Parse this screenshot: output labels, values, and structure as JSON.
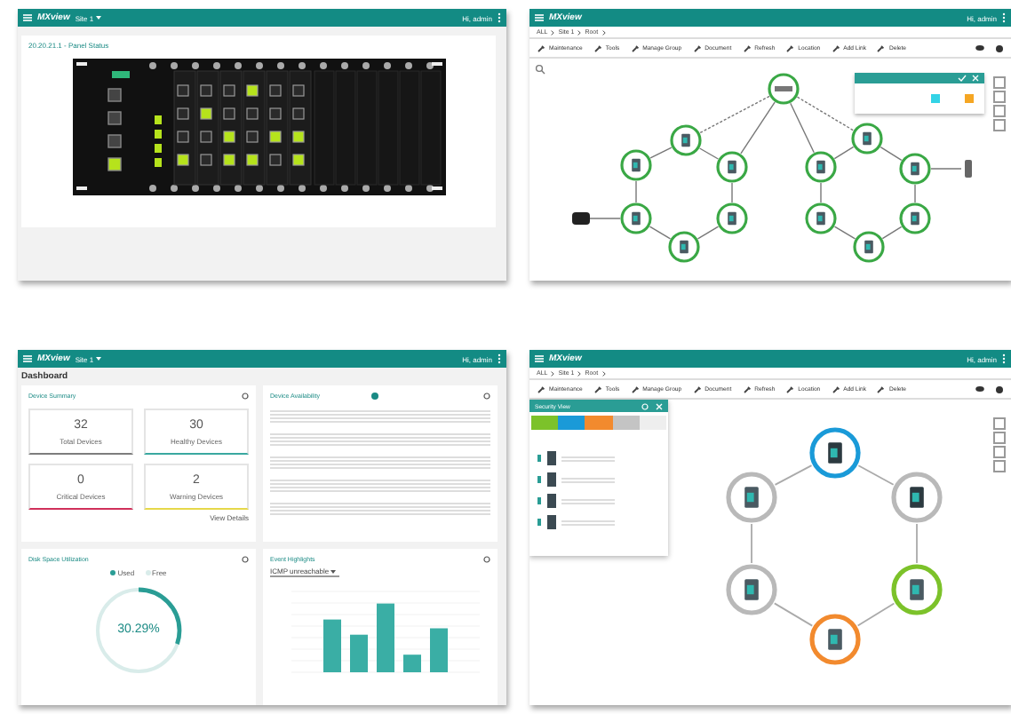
{
  "screens": [
    {
      "kind": "panel",
      "logo": "MXview",
      "site": "Site 1",
      "user": "Hi, admin",
      "panel_title": "20.20.21.1 - Panel Status"
    },
    {
      "kind": "topology",
      "logo": "MXview",
      "user": "Hi, admin",
      "breadcrumb": [
        "ALL",
        "Site 1",
        "Root"
      ],
      "toolbar": [
        "Maintenance",
        "Tools",
        "Manage Group",
        "Document",
        "Refresh",
        "Location",
        "Add Link",
        "Delete"
      ],
      "legend": [
        {
          "color": "#33d3e6"
        },
        {
          "color": "#f5a623"
        }
      ]
    },
    {
      "kind": "dashboard",
      "logo": "MXview",
      "site": "Site 1",
      "user": "Hi, admin",
      "title": "Dashboard",
      "summary": {
        "title": "Device Summary",
        "tiles": [
          {
            "value": "32",
            "label": "Total Devices",
            "color": "#7d7d7d"
          },
          {
            "value": "30",
            "label": "Healthy Devices",
            "color": "#3aa8a0"
          },
          {
            "value": "0",
            "label": "Critical Devices",
            "color": "#d0305a"
          },
          {
            "value": "2",
            "label": "Warning Devices",
            "color": "#e6d84a"
          }
        ],
        "link": "View Details"
      },
      "availability": {
        "title": "Device Availability"
      },
      "disk": {
        "title": "Disk Space Utilization",
        "legend": [
          {
            "label": "Used",
            "color": "#2a9d95"
          },
          {
            "label": "Free",
            "color": "#d9ecea"
          }
        ],
        "value": "30.29%",
        "level": 0.3029
      },
      "events": {
        "title": "Event Highlights",
        "filter": "ICMP unreachable"
      }
    },
    {
      "kind": "security",
      "logo": "MXview",
      "user": "Hi, admin",
      "breadcrumb": [
        "ALL",
        "Site 1",
        "Root"
      ],
      "toolbar": [
        "Maintenance",
        "Tools",
        "Manage Group",
        "Document",
        "Refresh",
        "Location",
        "Add Link",
        "Delete"
      ],
      "panel_title": "Security View",
      "legend": [
        {
          "color": "#7cc22a"
        },
        {
          "color": "#1a9ad8"
        },
        {
          "color": "#f28a2e"
        },
        {
          "color": "#c4c4c4"
        },
        {
          "color": "#eeeeee"
        }
      ],
      "nodes": [
        {
          "color": "#1a9ad8"
        },
        {
          "color": "#b9b9b9"
        },
        {
          "color": "#b9b9b9"
        },
        {
          "color": "#b9b9b9"
        },
        {
          "color": "#7cc22a"
        },
        {
          "color": "#f28a2e"
        }
      ]
    }
  ]
}
